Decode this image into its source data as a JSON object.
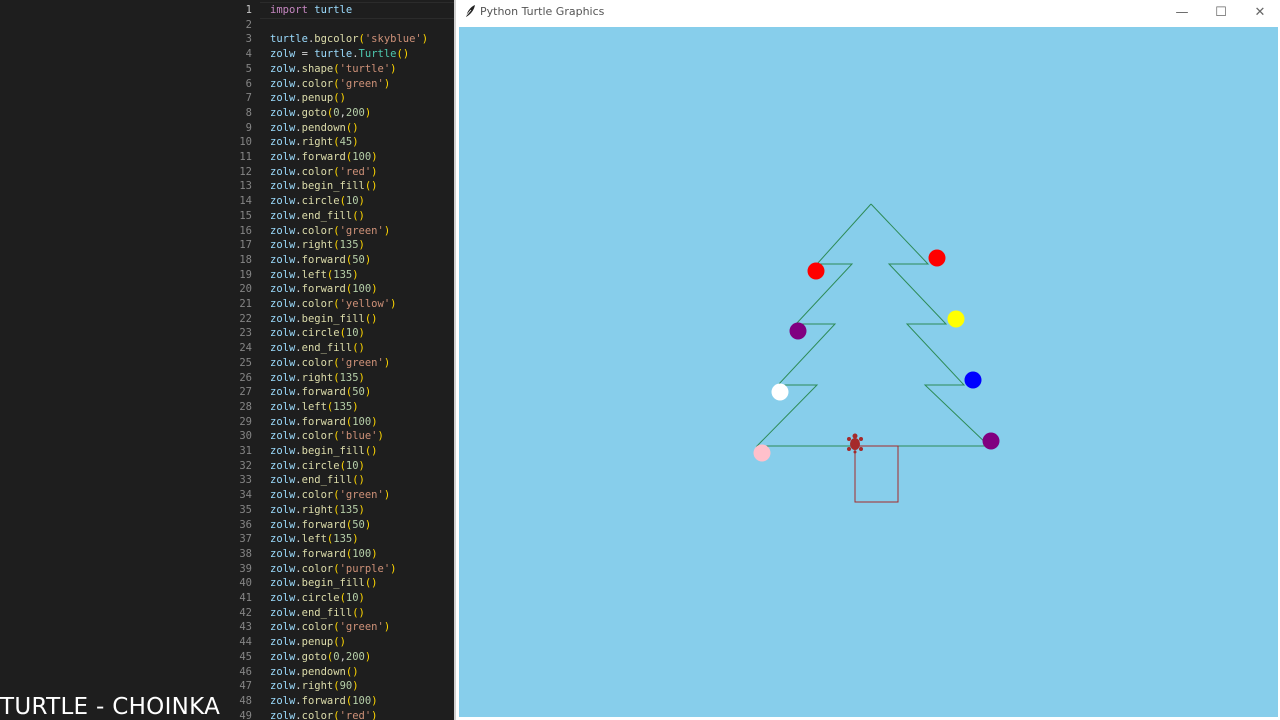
{
  "editor": {
    "current_line": 1,
    "lines": [
      "import turtle",
      "",
      "turtle.bgcolor('skyblue')",
      "zolw = turtle.Turtle()",
      "zolw.shape('turtle')",
      "zolw.color('green')",
      "zolw.penup()",
      "zolw.goto(0,200)",
      "zolw.pendown()",
      "zolw.right(45)",
      "zolw.forward(100)",
      "zolw.color('red')",
      "zolw.begin_fill()",
      "zolw.circle(10)",
      "zolw.end_fill()",
      "zolw.color('green')",
      "zolw.right(135)",
      "zolw.forward(50)",
      "zolw.left(135)",
      "zolw.forward(100)",
      "zolw.color('yellow')",
      "zolw.begin_fill()",
      "zolw.circle(10)",
      "zolw.end_fill()",
      "zolw.color('green')",
      "zolw.right(135)",
      "zolw.forward(50)",
      "zolw.left(135)",
      "zolw.forward(100)",
      "zolw.color('blue')",
      "zolw.begin_fill()",
      "zolw.circle(10)",
      "zolw.end_fill()",
      "zolw.color('green')",
      "zolw.right(135)",
      "zolw.forward(50)",
      "zolw.left(135)",
      "zolw.forward(100)",
      "zolw.color('purple')",
      "zolw.begin_fill()",
      "zolw.circle(10)",
      "zolw.end_fill()",
      "zolw.color('green')",
      "zolw.penup()",
      "zolw.goto(0,200)",
      "zolw.pendown()",
      "zolw.right(90)",
      "zolw.forward(100)",
      "zolw.color('red')"
    ]
  },
  "caption": "TURTLE - CHOINKA",
  "window": {
    "title": "Python Turtle Graphics",
    "minimize_glyph": "—",
    "maximize_glyph": "☐",
    "close_glyph": "✕"
  },
  "canvas": {
    "background": "#87ceeb",
    "tree_color": "#2e8b57",
    "trunk_color": "#a52a2a",
    "turtle_color": "#a52a2a",
    "ornaments": [
      {
        "name": "ornament-red-left",
        "color": "#ff0000"
      },
      {
        "name": "ornament-red-right",
        "color": "#ff0000"
      },
      {
        "name": "ornament-purple-left",
        "color": "#800080"
      },
      {
        "name": "ornament-yellow",
        "color": "#ffff00"
      },
      {
        "name": "ornament-white",
        "color": "#ffffff"
      },
      {
        "name": "ornament-blue",
        "color": "#0000ff"
      },
      {
        "name": "ornament-pink",
        "color": "#ffc0cb"
      },
      {
        "name": "ornament-purple-right",
        "color": "#800080"
      }
    ]
  }
}
